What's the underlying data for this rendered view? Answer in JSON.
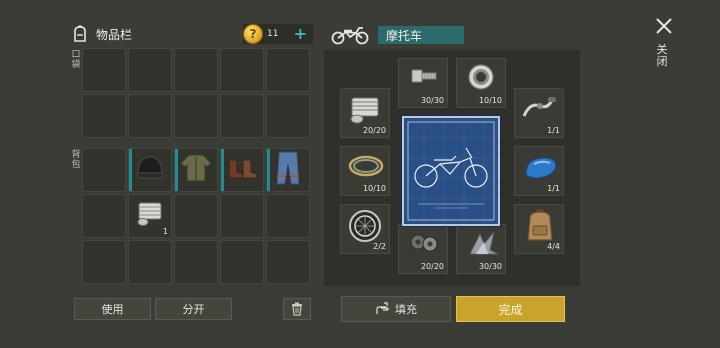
{
  "inventory": {
    "title": "物品栏",
    "pocket_label": "口袋",
    "backpack_label": "背包",
    "coin_symbol": "?",
    "coins": "11",
    "pocket_slots": 10,
    "backpack_items": [
      {
        "icon": "",
        "count": ""
      },
      {
        "icon": "beanie-icon",
        "count": "",
        "equipped": true
      },
      {
        "icon": "jacket-icon",
        "count": "",
        "equipped": true
      },
      {
        "icon": "boots-icon",
        "count": "",
        "equipped": true
      },
      {
        "icon": "jeans-icon",
        "count": "",
        "equipped": true
      },
      {
        "icon": "",
        "count": ""
      },
      {
        "icon": "engine-cylinder-icon",
        "count": "1"
      },
      {
        "icon": "",
        "count": ""
      },
      {
        "icon": "",
        "count": ""
      },
      {
        "icon": "",
        "count": ""
      },
      {
        "icon": "",
        "count": ""
      },
      {
        "icon": "",
        "count": ""
      },
      {
        "icon": "",
        "count": ""
      },
      {
        "icon": "",
        "count": ""
      },
      {
        "icon": "",
        "count": ""
      }
    ],
    "use_label": "使用",
    "split_label": "分开"
  },
  "crafting": {
    "title": "摩托车",
    "parts": [
      {
        "name": "bolt",
        "icon": "bolt-icon",
        "count": "30/30"
      },
      {
        "name": "bearing",
        "icon": "bearing-icon",
        "count": "10/10"
      },
      {
        "name": "engine",
        "icon": "engine-cylinder-icon",
        "count": "20/20"
      },
      {
        "name": "handlebar",
        "icon": "handlebar-icon",
        "count": "1/1"
      },
      {
        "name": "wires",
        "icon": "wire-icon",
        "count": "10/10"
      },
      {
        "name": "fuel-tank",
        "icon": "fuel-tank-icon",
        "count": "1/1"
      },
      {
        "name": "wheel",
        "icon": "wheel-icon",
        "count": "2/2"
      },
      {
        "name": "gaskets",
        "icon": "gasket-icon",
        "count": "20/20"
      },
      {
        "name": "scrap",
        "icon": "scrap-metal-icon",
        "count": "30/30"
      },
      {
        "name": "backpack",
        "icon": "backpack-icon",
        "count": "4/4"
      }
    ],
    "fill_label": "填充",
    "done_label": "完成"
  },
  "close_label": "关闭",
  "colors": {
    "accent": "#3fb4c8",
    "equipped": "#1f8f93",
    "done": "#c8a42a"
  }
}
